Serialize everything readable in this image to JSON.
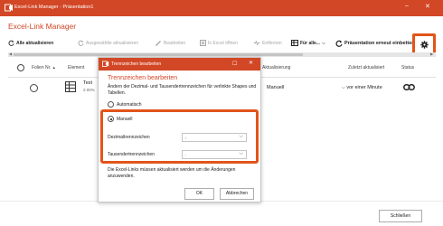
{
  "window": {
    "title": "Excel-Link Manager - Präsentation1",
    "minimize": "–",
    "close": "✕"
  },
  "heading": "Excel-Link Manager",
  "toolbar": {
    "update_all": "Alle aktualisieren",
    "update_selected": "Ausgewählte aktualisieren",
    "edit": "Bearbeiten",
    "open_excel": "In Excel öffnen",
    "remove": "Entfernen",
    "for_all": "Für alle...",
    "reinsert": "Präsentation erneut einbetten"
  },
  "columns": {
    "slide_no": "Folien Nr.",
    "element": "Element",
    "update": "Aktualisierung",
    "last_updated": "Zuletzt aktualisiert",
    "status": "Status"
  },
  "row": {
    "element_text": "Text",
    "element_sub": "2.00%",
    "update": "Manuell",
    "last_updated": "vor einer Minute"
  },
  "dialog": {
    "title": "Trennzeichen bearbeiten",
    "heading": "Trennzeichen bearbeiten",
    "description": "Ändern der Dezimal- und Tausendertrennzeichen für verlinkte Shapes und Tabellen.",
    "option_auto": "Automatisch",
    "option_manual": "Manuell",
    "decimal_label": "Dezimaltrennzeichen",
    "decimal_value": ",",
    "thousands_label": "Tausendertrennzeichen",
    "thousands_value": ".",
    "note": "Die Excel-Links müssen aktualisiert werden um die Änderungen anzuwenden.",
    "ok": "OK",
    "cancel": "Abbrechen",
    "selected_option": "Manuell"
  },
  "footer": {
    "close_button": "Schließen"
  },
  "colors": {
    "accent": "#d24726",
    "highlight": "#e2541a",
    "disabled": "#a6a6a6"
  }
}
